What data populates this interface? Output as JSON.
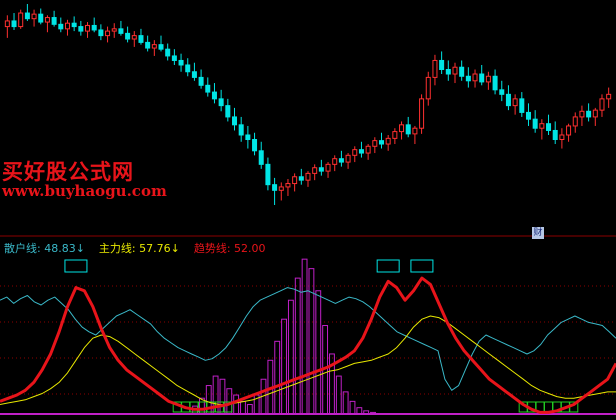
{
  "watermark": {
    "cn": "买好股公式网",
    "url": "www.buyhaogu.com"
  },
  "badge": {
    "label": "财"
  },
  "legend": {
    "sanhu": {
      "label": "散户线",
      "value": "48.83",
      "arrow": "↓",
      "color": "#3ab8c8"
    },
    "zhuli": {
      "label": "主力线",
      "value": "57.76",
      "arrow": "↓",
      "color": "#e8e800"
    },
    "qushi": {
      "label": "趋势线",
      "value": "52.00",
      "color": "#e8141a"
    }
  },
  "colors": {
    "up": "#ff3030",
    "down": "#00e5e5",
    "retail": "#3ab8c8",
    "main": "#e8e800",
    "trend": "#e8141a",
    "volume": "#c020c8",
    "signal": "#22cc22",
    "grid": "#8b0000"
  },
  "chart_data": [
    {
      "type": "candlestick",
      "note": "price units are arbitrary (no axis labels printed)",
      "candles": [
        [
          500,
          510,
          490,
          505
        ],
        [
          505,
          512,
          497,
          500
        ],
        [
          500,
          515,
          498,
          512
        ],
        [
          512,
          520,
          505,
          507
        ],
        [
          507,
          515,
          500,
          511
        ],
        [
          511,
          516,
          502,
          504
        ],
        [
          504,
          510,
          495,
          508
        ],
        [
          508,
          514,
          500,
          502
        ],
        [
          502,
          508,
          495,
          498
        ],
        [
          498,
          506,
          492,
          503
        ],
        [
          503,
          509,
          496,
          500
        ],
        [
          500,
          505,
          492,
          496
        ],
        [
          496,
          504,
          490,
          501
        ],
        [
          501,
          508,
          495,
          497
        ],
        [
          497,
          502,
          488,
          492
        ],
        [
          492,
          500,
          486,
          496
        ],
        [
          496,
          503,
          490,
          498
        ],
        [
          498,
          505,
          492,
          494
        ],
        [
          494,
          500,
          486,
          489
        ],
        [
          489,
          496,
          482,
          492
        ],
        [
          492,
          498,
          484,
          486
        ],
        [
          486,
          492,
          478,
          481
        ],
        [
          481,
          488,
          474,
          484
        ],
        [
          484,
          492,
          478,
          480
        ],
        [
          480,
          485,
          470,
          474
        ],
        [
          474,
          480,
          466,
          470
        ],
        [
          470,
          476,
          460,
          466
        ],
        [
          466,
          472,
          456,
          460
        ],
        [
          460,
          468,
          452,
          455
        ],
        [
          455,
          462,
          445,
          448
        ],
        [
          448,
          455,
          438,
          442
        ],
        [
          442,
          450,
          432,
          436
        ],
        [
          436,
          444,
          425,
          430
        ],
        [
          430,
          436,
          416,
          420
        ],
        [
          420,
          428,
          408,
          413
        ],
        [
          413,
          420,
          398,
          404
        ],
        [
          404,
          412,
          392,
          400
        ],
        [
          400,
          406,
          386,
          390
        ],
        [
          390,
          398,
          374,
          378
        ],
        [
          378,
          384,
          355,
          360
        ],
        [
          360,
          366,
          342,
          355
        ],
        [
          355,
          362,
          346,
          358
        ],
        [
          358,
          365,
          350,
          361
        ],
        [
          361,
          370,
          354,
          367
        ],
        [
          367,
          374,
          360,
          364
        ],
        [
          364,
          372,
          358,
          370
        ],
        [
          370,
          378,
          364,
          375
        ],
        [
          375,
          382,
          368,
          372
        ],
        [
          372,
          380,
          366,
          378
        ],
        [
          378,
          386,
          372,
          383
        ],
        [
          383,
          390,
          376,
          380
        ],
        [
          380,
          388,
          374,
          386
        ],
        [
          386,
          394,
          380,
          391
        ],
        [
          391,
          398,
          384,
          388
        ],
        [
          388,
          396,
          382,
          394
        ],
        [
          394,
          402,
          388,
          399
        ],
        [
          399,
          406,
          392,
          396
        ],
        [
          396,
          404,
          390,
          401
        ],
        [
          401,
          410,
          396,
          407
        ],
        [
          407,
          416,
          400,
          413
        ],
        [
          413,
          420,
          402,
          405
        ],
        [
          405,
          412,
          396,
          410
        ],
        [
          410,
          440,
          405,
          436
        ],
        [
          436,
          460,
          430,
          455
        ],
        [
          455,
          475,
          448,
          470
        ],
        [
          470,
          478,
          458,
          462
        ],
        [
          462,
          470,
          452,
          458
        ],
        [
          458,
          468,
          450,
          464
        ],
        [
          464,
          470,
          452,
          456
        ],
        [
          456,
          464,
          446,
          452
        ],
        [
          452,
          462,
          446,
          458
        ],
        [
          458,
          466,
          448,
          451
        ],
        [
          451,
          460,
          444,
          456
        ],
        [
          456,
          462,
          440,
          444
        ],
        [
          444,
          452,
          434,
          440
        ],
        [
          440,
          448,
          426,
          430
        ],
        [
          430,
          440,
          422,
          436
        ],
        [
          436,
          442,
          420,
          424
        ],
        [
          424,
          432,
          412,
          418
        ],
        [
          418,
          426,
          406,
          410
        ],
        [
          410,
          418,
          400,
          414
        ],
        [
          414,
          422,
          404,
          408
        ],
        [
          408,
          416,
          396,
          400
        ],
        [
          400,
          410,
          392,
          404
        ],
        [
          404,
          414,
          398,
          412
        ],
        [
          412,
          424,
          406,
          420
        ],
        [
          420,
          430,
          412,
          425
        ],
        [
          425,
          432,
          416,
          420
        ],
        [
          420,
          428,
          412,
          426
        ],
        [
          426,
          440,
          420,
          436
        ],
        [
          436,
          446,
          428,
          440
        ]
      ]
    },
    {
      "type": "line",
      "title": "",
      "ylim": [
        0,
        100
      ],
      "series": [
        {
          "name": "散户线",
          "color": "#3ab8c8",
          "values": [
            72,
            74,
            70,
            73,
            75,
            71,
            69,
            72,
            74,
            70,
            66,
            60,
            55,
            52,
            50,
            54,
            58,
            62,
            64,
            66,
            63,
            60,
            57,
            52,
            48,
            45,
            42,
            40,
            38,
            36,
            34,
            35,
            38,
            42,
            48,
            55,
            62,
            68,
            72,
            74,
            76,
            78,
            80,
            79,
            77,
            78,
            76,
            74,
            72,
            70,
            72,
            74,
            73,
            71,
            68,
            64,
            60,
            56,
            52,
            50,
            48,
            46,
            44,
            42,
            40,
            22,
            15,
            18,
            28,
            38,
            46,
            50,
            48,
            46,
            44,
            42,
            40,
            38,
            40,
            44,
            50,
            54,
            58,
            60,
            62,
            60,
            58,
            57,
            56,
            52,
            48
          ]
        },
        {
          "name": "主力线",
          "color": "#e8e800",
          "values": [
            6,
            7,
            8,
            9,
            11,
            13,
            16,
            20,
            26,
            34,
            42,
            48,
            50,
            49,
            46,
            42,
            38,
            34,
            30,
            26,
            22,
            18,
            15,
            12,
            9,
            7,
            6,
            6,
            7,
            8,
            9,
            11,
            13,
            15,
            17,
            19,
            21,
            23,
            25,
            27,
            28,
            30,
            32,
            33,
            34,
            36,
            38,
            42,
            48,
            55,
            60,
            62,
            61,
            58,
            54,
            50,
            46,
            42,
            38,
            34,
            30,
            26,
            22,
            18,
            15,
            13,
            11,
            10,
            10,
            11,
            12,
            13,
            14,
            14
          ]
        },
        {
          "name": "趋势线",
          "color": "#e8141a",
          "values": [
            8,
            10,
            12,
            15,
            20,
            28,
            38,
            52,
            68,
            80,
            78,
            68,
            54,
            42,
            34,
            28,
            24,
            20,
            16,
            12,
            8,
            6,
            4,
            3,
            3,
            4,
            5,
            6,
            8,
            10,
            12,
            14,
            16,
            18,
            20,
            22,
            24,
            26,
            28,
            30,
            33,
            36,
            40,
            48,
            60,
            74,
            84,
            80,
            72,
            78,
            86,
            82,
            70,
            58,
            48,
            40,
            34,
            28,
            22,
            18,
            14,
            10,
            6,
            3,
            1,
            1,
            2,
            4,
            6,
            10,
            14,
            18,
            22,
            32
          ]
        }
      ]
    },
    {
      "type": "bar",
      "name": "volume-histogram",
      "color": "#c020c8",
      "values": [
        0,
        0,
        0,
        0,
        0,
        0,
        0,
        0,
        0,
        0,
        0,
        0,
        0,
        0,
        0,
        0,
        0,
        0,
        0,
        0,
        0,
        0,
        0,
        0,
        0,
        0,
        0,
        0,
        5,
        10,
        18,
        24,
        22,
        16,
        12,
        8,
        6,
        12,
        22,
        34,
        46,
        60,
        72,
        86,
        98,
        92,
        78,
        56,
        38,
        24,
        14,
        8,
        4,
        2,
        1,
        0,
        0,
        0,
        0,
        0,
        0,
        0,
        0,
        0,
        0,
        0,
        0,
        0,
        0,
        0,
        0,
        0,
        0,
        0,
        0,
        0,
        0,
        0,
        0,
        0,
        0,
        0,
        0,
        0,
        0,
        0,
        0,
        0,
        0,
        0
      ]
    }
  ]
}
